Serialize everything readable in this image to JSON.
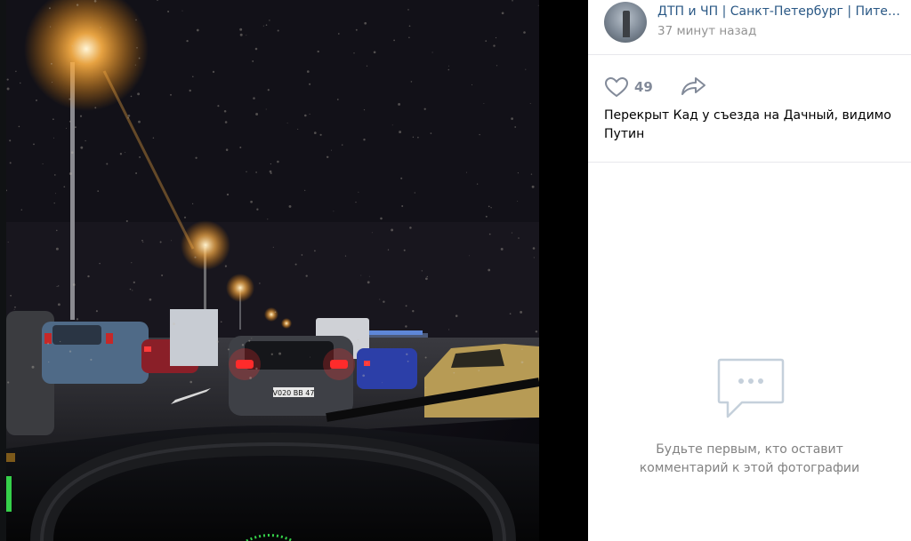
{
  "post": {
    "group_name": "ДТП и ЧП | Санкт-Петербург | Питер онлайн",
    "time": "37 минут назад",
    "likes": "49",
    "caption": "Перекрыт Кад у съезда на Дачный, видимо Путин"
  },
  "photo": {
    "license_plate": "V020 ВВ 47"
  },
  "comments": {
    "empty_text": "Будьте первым, кто оставит комментарий к этой фотографии"
  },
  "icons": {
    "like": "heart-icon",
    "share": "share-arrow-icon",
    "comments_empty": "comment-bubble-icon"
  },
  "colors": {
    "link": "#2a5885",
    "muted": "#939393",
    "counter": "#828a99"
  }
}
